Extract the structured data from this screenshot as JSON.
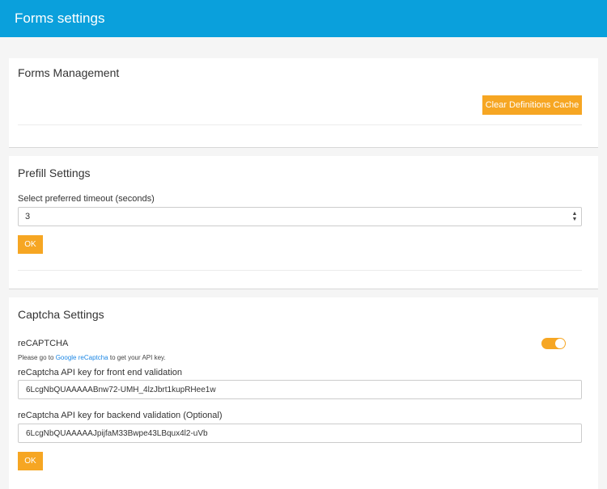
{
  "header": {
    "title": "Forms settings"
  },
  "forms_management": {
    "title": "Forms Management",
    "clear_cache_label": "Clear Definitions Cache"
  },
  "prefill": {
    "title": "Prefill Settings",
    "timeout_label": "Select preferred timeout (seconds)",
    "timeout_value": "3",
    "ok_label": "OK"
  },
  "captcha": {
    "title": "Captcha Settings",
    "recaptcha_label": "reCAPTCHA",
    "recaptcha_enabled": true,
    "hint_prefix": "Please go to ",
    "hint_link": "Google reCaptcha",
    "hint_suffix": " to get your API key.",
    "frontend_label": "reCaptcha API key for front end validation",
    "frontend_value": "6LcgNbQUAAAAABnw72-UMH_4lzJbrt1kupRHee1w",
    "backend_label": "reCaptcha API key for backend validation (Optional)",
    "backend_value": "6LcgNbQUAAAAAJpijfaM33Bwpe43LBqux4l2-uVb",
    "ok_label": "OK"
  },
  "colors": {
    "header": "#0aa0dc",
    "accent": "#f6a623",
    "link": "#1e88e5"
  }
}
